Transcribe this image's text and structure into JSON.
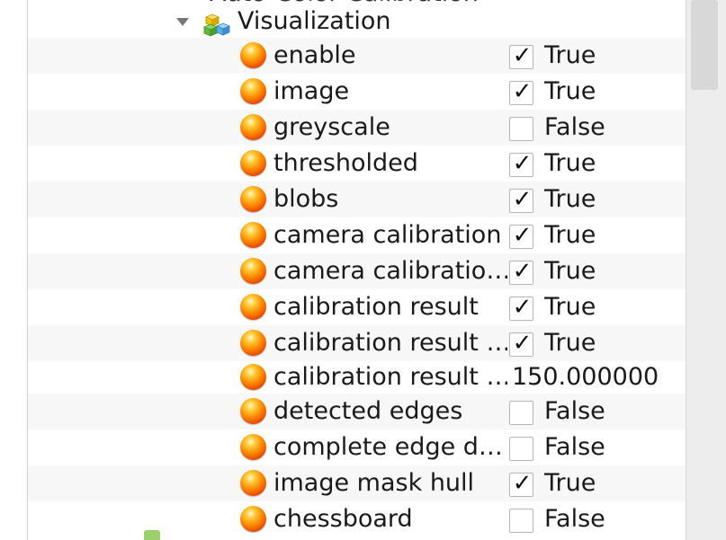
{
  "tree": {
    "partial_top_label": "Auto-Color Calibration",
    "group": {
      "label": "Visualization",
      "expanded": true
    },
    "items": [
      {
        "label": "enable",
        "type": "bool",
        "checked": true,
        "value": "True"
      },
      {
        "label": "image",
        "type": "bool",
        "checked": true,
        "value": "True"
      },
      {
        "label": "greyscale",
        "type": "bool",
        "checked": false,
        "value": "False"
      },
      {
        "label": "thresholded",
        "type": "bool",
        "checked": true,
        "value": "True"
      },
      {
        "label": "blobs",
        "type": "bool",
        "checked": true,
        "value": "True"
      },
      {
        "label": "camera calibration",
        "type": "bool",
        "checked": true,
        "value": "True"
      },
      {
        "label": "camera calibratio…",
        "type": "bool",
        "checked": true,
        "value": "True"
      },
      {
        "label": "calibration result",
        "type": "bool",
        "checked": true,
        "value": "True"
      },
      {
        "label": "calibration result …",
        "type": "bool",
        "checked": true,
        "value": "True"
      },
      {
        "label": "calibration result …",
        "type": "number",
        "value": "150.000000"
      },
      {
        "label": "detected edges",
        "type": "bool",
        "checked": false,
        "value": "False"
      },
      {
        "label": "complete edge d…",
        "type": "bool",
        "checked": false,
        "value": "False"
      },
      {
        "label": "image mask hull",
        "type": "bool",
        "checked": true,
        "value": "True"
      },
      {
        "label": "chessboard",
        "type": "bool",
        "checked": false,
        "value": "False"
      }
    ]
  },
  "icons": {
    "item_icon": "orange-orb-icon",
    "group_icon": "cubes-icon",
    "expand_icon": "triangle-down-icon",
    "check_mark": "✓"
  },
  "colors": {
    "row_alt": "#f7f7f7",
    "orb": "#ff8a00"
  }
}
